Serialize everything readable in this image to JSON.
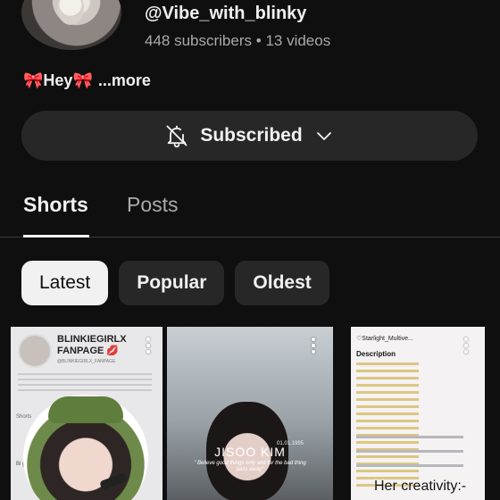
{
  "channel": {
    "handle": "@Vibe_with_blinky",
    "subscribers": "448 subscribers",
    "separator": "•",
    "videos": "13 videos",
    "description_text": "Hey",
    "more_label": "...more"
  },
  "subscribe": {
    "label": "Subscribed"
  },
  "tabs": [
    {
      "label": "Shorts",
      "active": true
    },
    {
      "label": "Posts",
      "active": false
    }
  ],
  "chips": [
    {
      "label": "Latest",
      "active": true
    },
    {
      "label": "Popular",
      "active": false
    },
    {
      "label": "Oldest",
      "active": false
    }
  ],
  "thumbnails": [
    {
      "title": "BLINKIEGIRLX FANPAGE",
      "subtitle": "@BLINKIEGIRLX_FANPAGE",
      "side": "Shorts",
      "side2": "Bi got"
    },
    {
      "title": "JISOO KIM",
      "date": "01.01.1995",
      "quote": "\" Believe good things only and for the bad thing pass away\""
    },
    {
      "bar_title": "♡Starlight_Multive...",
      "desc": "Description",
      "caption": "Her creativity:-"
    }
  ],
  "colors": {
    "background": "#0f0f0f",
    "surface": "#272727",
    "text": "#f1f1f1",
    "muted": "#aaaaaa",
    "bow": "#e53935"
  },
  "icons": [
    "bell-off-icon",
    "chevron-down-icon",
    "more-vert-icon",
    "bow-icon"
  ]
}
